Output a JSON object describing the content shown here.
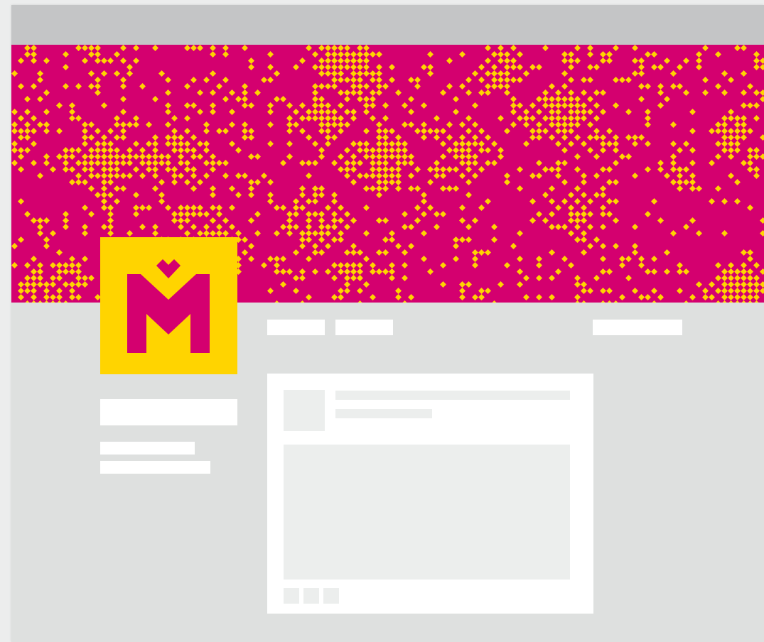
{
  "colors": {
    "cover_background": "#d4006f",
    "pattern_yellow": "#ffd400",
    "logo_background": "#ffd400",
    "logo_letter": "#d4006f",
    "window_background": "#dee0df",
    "topbar": "#c4c5c6",
    "placeholder": "#ffffff",
    "placeholder_inner": "#eceeed"
  },
  "profile": {
    "avatar_icon": "m-letter-logo-icon",
    "cover_pattern": "pixel-folk-pattern"
  },
  "tabs": [
    {
      "name": "tab-1"
    },
    {
      "name": "tab-2"
    }
  ],
  "post": {
    "actions": [
      "action-1",
      "action-2",
      "action-3"
    ]
  }
}
